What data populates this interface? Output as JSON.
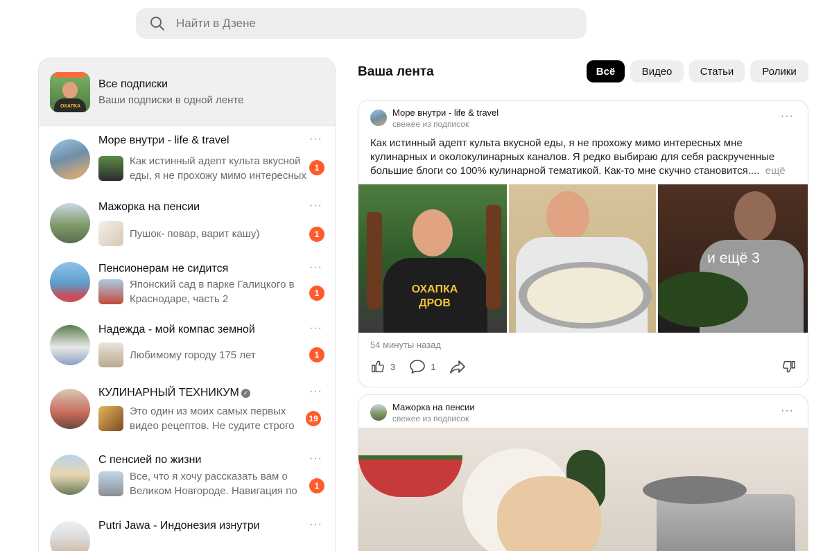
{
  "search": {
    "placeholder": "Найти в Дзене"
  },
  "sidebar": {
    "all": {
      "title": "Все подписки",
      "subtitle": "Ваши подписки в одной ленте"
    },
    "channels": [
      {
        "name": "Море внутри - life & travel",
        "preview": "Как истинный адепт культа вкусной еды, я не прохожу мимо интересных мне",
        "badge": "1"
      },
      {
        "name": "Мажорка на пенсии",
        "preview": "Пушок- повар, варит кашу)",
        "badge": "1"
      },
      {
        "name": "Пенсионерам не сидится",
        "preview": "Японский сад в парке Галицкого в Краснодаре, часть 2",
        "badge": "1"
      },
      {
        "name": "Надежда - мой компас земной",
        "preview": "Любимому городу 175 лет",
        "badge": "1"
      },
      {
        "name": "КУЛИНАРНЫЙ ТЕХНИКУМ",
        "preview": "Это один из моих самых первых видео рецептов. Не судите строго",
        "badge": "19",
        "verified": "✓"
      },
      {
        "name": "С пенсией по жизни",
        "preview": "Все, что я хочу рассказать вам о Великом Новгороде. Навигация по каналу",
        "badge": "1"
      },
      {
        "name": "Putri Jawa - Индонезия изнутри"
      }
    ],
    "more_label": "···"
  },
  "feed": {
    "title": "Ваша лента",
    "filters": [
      "Всё",
      "Видео",
      "Статьи",
      "Ролики"
    ],
    "active_filter": "Всё",
    "posts": [
      {
        "channel": "Море внутри - life & travel",
        "source": "свежее из подписок",
        "text": "Как истинный адепт культа вкусной еды, я не прохожу мимо интересных мне кулинарных и околокулинарных каналов. Я редко выбираю для себя раскрученные большие блоги со 100% кулинарной тематикой. Как-то мне скучно становится....",
        "more": "ещё",
        "extra_photos": "и ещё 3",
        "shirt_text": "ОХАПКА ДРОВ",
        "time": "54 минуты назад",
        "likes": "3",
        "comments": "1"
      },
      {
        "channel": "Мажорка на пенсии",
        "source": "свежее из подписок"
      }
    ]
  },
  "colors": {
    "badge": "#ff5b2c",
    "active_filter_bg": "#000000",
    "accent_avatar_tab": "#ff6a3d"
  }
}
